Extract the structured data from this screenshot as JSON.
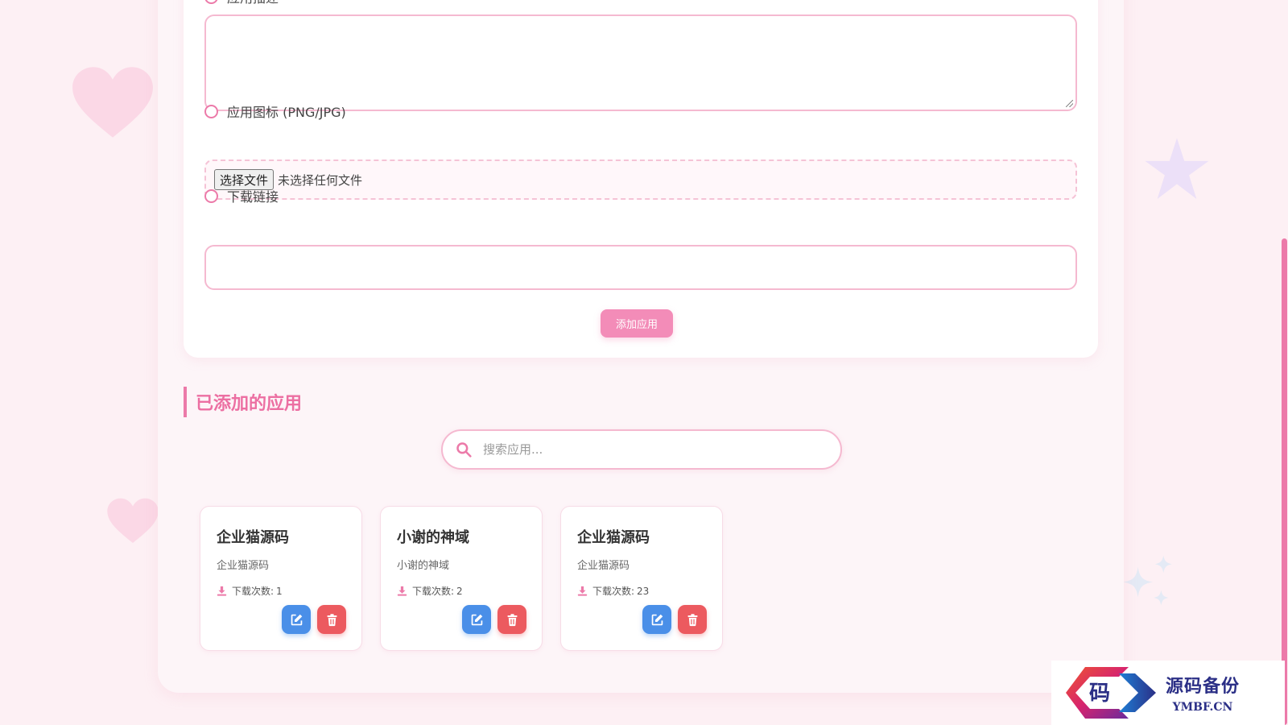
{
  "form": {
    "description_label": "应用描述",
    "icon_label": "应用图标 (PNG/JPG)",
    "file_button": "选择文件",
    "file_status": "未选择任何文件",
    "download_link_label": "下载链接",
    "add_button": "添加应用"
  },
  "apps_section": {
    "title": "已添加的应用",
    "search_placeholder": "搜索应用..."
  },
  "apps": [
    {
      "title": "企业猫源码",
      "desc": "企业猫源码",
      "downloads_label": "下载次数:",
      "downloads": 1
    },
    {
      "title": "小谢的神域",
      "desc": "小谢的神域",
      "downloads_label": "下载次数:",
      "downloads": 2
    },
    {
      "title": "企业猫源码",
      "desc": "企业猫源码",
      "downloads_label": "下载次数:",
      "downloads": 23
    }
  ],
  "watermark": {
    "logo_char": "码",
    "name": "源码备份",
    "domain": "YMBF.CN"
  },
  "colors": {
    "accent": "#ec7aa9",
    "edit": "#4a8fe8",
    "delete": "#ec5a5f",
    "background": "#fdf0f4"
  },
  "icons": [
    "heart-icon",
    "star-icon",
    "sparkle-icon",
    "search-icon",
    "download-icon",
    "edit-icon",
    "trash-icon"
  ]
}
